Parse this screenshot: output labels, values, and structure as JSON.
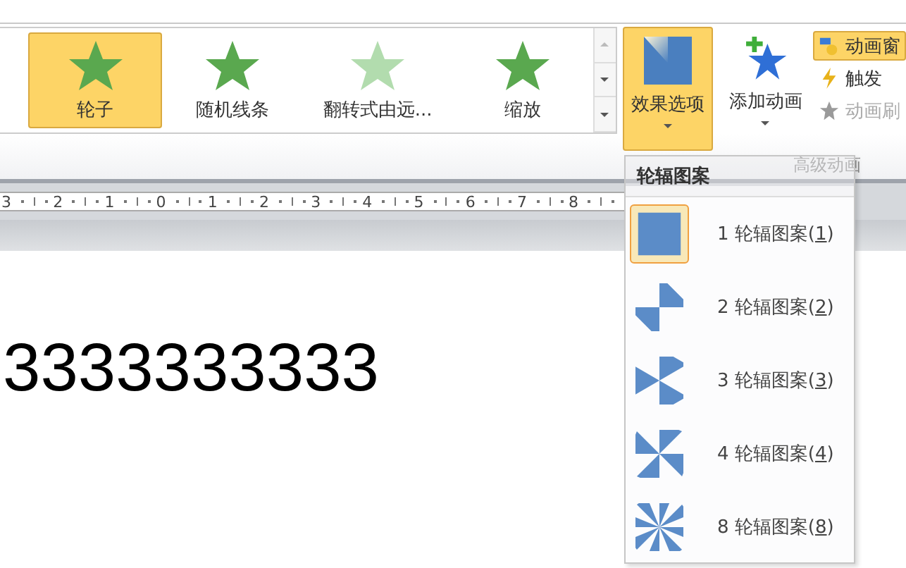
{
  "gallery": {
    "items": [
      {
        "label": "轮子",
        "selected": true
      },
      {
        "label": "随机线条",
        "selected": false
      },
      {
        "label": "翻转式由远...",
        "selected": false
      },
      {
        "label": "缩放",
        "selected": false
      }
    ]
  },
  "effect_options": {
    "label": "效果选项",
    "selected": true
  },
  "add_animation": {
    "label": "添加动画"
  },
  "small_buttons": [
    {
      "label": "动画窗",
      "selected": true,
      "disabled": false
    },
    {
      "label": "触发",
      "selected": false,
      "disabled": false
    },
    {
      "label": "动画刷",
      "selected": false,
      "disabled": true
    }
  ],
  "group_label": "高级动画",
  "ruler": [
    "3",
    "2",
    "1",
    "0",
    "1",
    "2",
    "3",
    "4",
    "5",
    "6",
    "7",
    "8"
  ],
  "document_text": "3333333333",
  "menu": {
    "header": "轮辐图案",
    "items": [
      {
        "number": "1",
        "label": "轮辐图案(",
        "key": "1",
        "close": ")",
        "selected": true
      },
      {
        "number": "2",
        "label": "轮辐图案(",
        "key": "2",
        "close": ")",
        "selected": false
      },
      {
        "number": "3",
        "label": "轮辐图案(",
        "key": "3",
        "close": ")",
        "selected": false
      },
      {
        "number": "4",
        "label": "轮辐图案(",
        "key": "4",
        "close": ")",
        "selected": false
      },
      {
        "number": "8",
        "label": "轮辐图案(",
        "key": "8",
        "close": ")",
        "selected": false
      }
    ]
  }
}
